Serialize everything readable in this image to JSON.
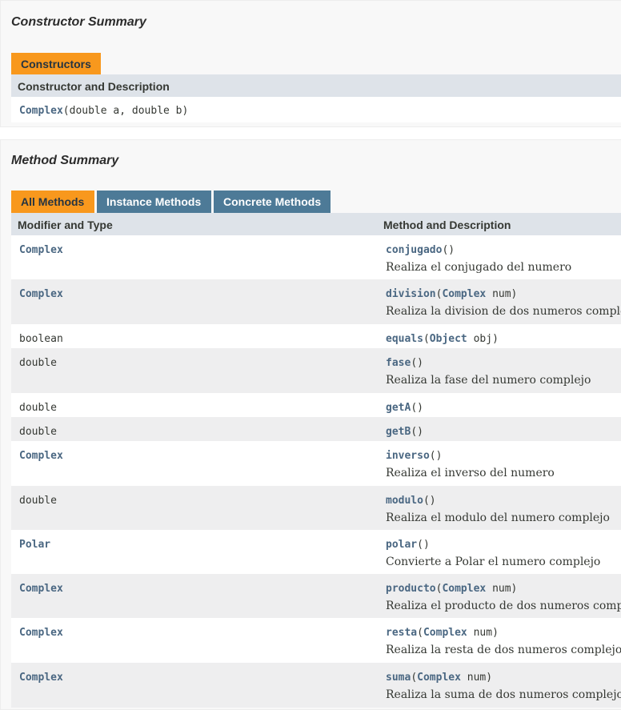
{
  "constructor_summary": {
    "title": "Constructor Summary",
    "tab_label": "Constructors",
    "header": "Constructor and Description",
    "constructor_name": "Complex",
    "constructor_params": "(double a, double b)"
  },
  "method_summary": {
    "title": "Method Summary",
    "tabs": [
      {
        "label": "All Methods",
        "active": true
      },
      {
        "label": "Instance Methods",
        "active": false
      },
      {
        "label": "Concrete Methods",
        "active": false
      }
    ],
    "headers": {
      "modifier": "Modifier and Type",
      "method": "Method and Description"
    },
    "rows": [
      {
        "type": "Complex",
        "name": "conjugado",
        "pre": "()",
        "ptype": "",
        "post": "",
        "desc": "Realiza el conjugado del numero"
      },
      {
        "type": "Complex",
        "name": "division",
        "pre": "(",
        "ptype": "Complex",
        "post": " num)",
        "desc": "Realiza la division de dos numeros complejos"
      },
      {
        "type": "boolean",
        "name": "equals",
        "pre": "(",
        "ptype": "Object",
        "post": " obj)",
        "desc": ""
      },
      {
        "type": "double",
        "name": "fase",
        "pre": "()",
        "ptype": "",
        "post": "",
        "desc": "Realiza la fase del numero complejo"
      },
      {
        "type": "double",
        "name": "getA",
        "pre": "()",
        "ptype": "",
        "post": "",
        "desc": ""
      },
      {
        "type": "double",
        "name": "getB",
        "pre": "()",
        "ptype": "",
        "post": "",
        "desc": ""
      },
      {
        "type": "Complex",
        "name": "inverso",
        "pre": "()",
        "ptype": "",
        "post": "",
        "desc": "Realiza el inverso del numero"
      },
      {
        "type": "double",
        "name": "modulo",
        "pre": "()",
        "ptype": "",
        "post": "",
        "desc": "Realiza el modulo del numero complejo"
      },
      {
        "type": "Polar",
        "name": "polar",
        "pre": "()",
        "ptype": "",
        "post": "",
        "desc": "Convierte a Polar el numero complejo"
      },
      {
        "type": "Complex",
        "name": "producto",
        "pre": "(",
        "ptype": "Complex",
        "post": " num)",
        "desc": "Realiza el producto de dos numeros complejos"
      },
      {
        "type": "Complex",
        "name": "resta",
        "pre": "(",
        "ptype": "Complex",
        "post": " num)",
        "desc": "Realiza la resta de dos numeros complejos"
      },
      {
        "type": "Complex",
        "name": "suma",
        "pre": "(",
        "ptype": "Complex",
        "post": " num)",
        "desc": "Realiza la suma de dos numeros complejos"
      }
    ]
  },
  "colors": {
    "active_tab": "#f8981d",
    "inactive_tab": "#4d7a97",
    "link": "#4a6782",
    "header_bg": "#dee3e9"
  }
}
